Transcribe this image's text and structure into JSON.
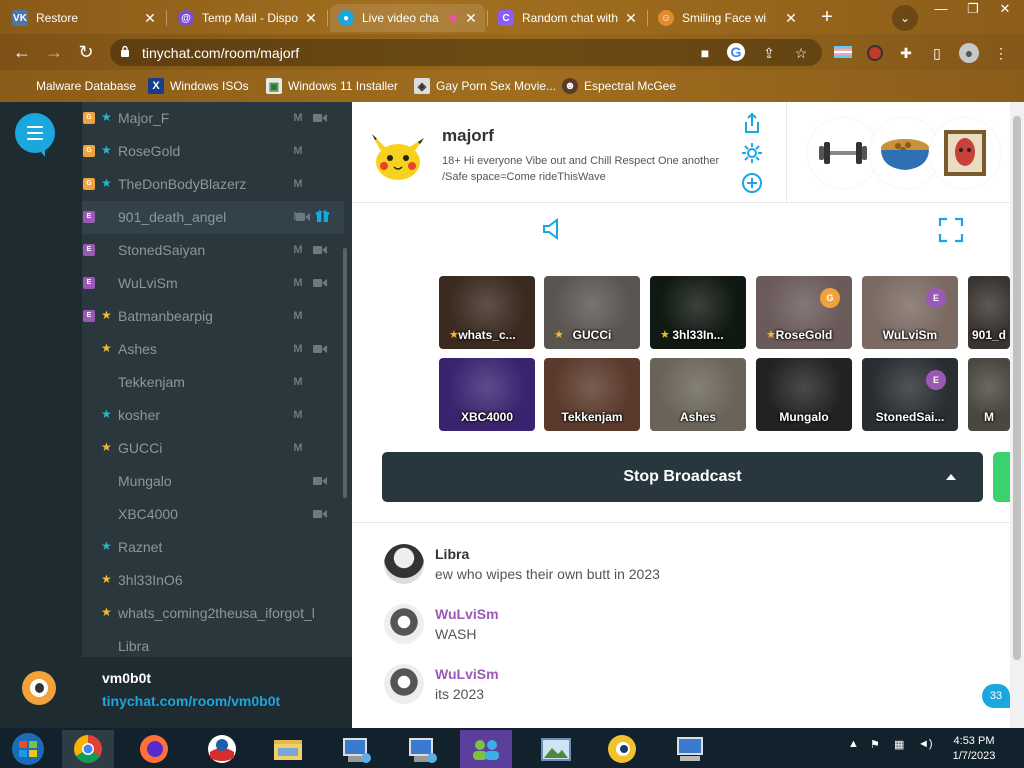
{
  "browser": {
    "tabs": [
      {
        "title": "Restore",
        "icon": "vk-icon",
        "color": "#4a76a8"
      },
      {
        "title": "Temp Mail - Dispo",
        "icon": "tempmail-icon",
        "color": "#7c4dd6"
      },
      {
        "title": "Live video cha",
        "icon": "tinychat-icon",
        "color": "#1aa6de"
      },
      {
        "title": "Random chat with",
        "icon": "chat-c-icon",
        "color": "#8b5cf6"
      },
      {
        "title": "Smiling Face wi",
        "icon": "emoji-icon",
        "color": "#e28b2c"
      }
    ],
    "new_tab": "+",
    "address": "tinychat.com/room/majorf",
    "bookmarks": [
      {
        "label": "Malware Database",
        "icon": "malware-icon"
      },
      {
        "label": "Windows ISOs",
        "icon": "x-icon"
      },
      {
        "label": "Windows 11 Installer",
        "icon": "installer-icon"
      },
      {
        "label": "Gay Porn Sex Movie...",
        "icon": "movie-icon"
      },
      {
        "label": "Espectral McGee",
        "icon": "profile-icon"
      }
    ]
  },
  "userlist": [
    {
      "badge": "G",
      "star": "blue",
      "name": "Major_F",
      "mic": true,
      "cam": true
    },
    {
      "badge": "G",
      "star": "blue",
      "name": "RoseGold",
      "mic": true,
      "cam": false
    },
    {
      "badge": "G",
      "star": "blue",
      "name": "TheDonBodyBlazerz",
      "mic": true,
      "cam": false
    },
    {
      "badge": "E",
      "star": "",
      "name": "901_death_angel",
      "mic": true,
      "cam": true,
      "gift": true
    },
    {
      "badge": "E",
      "star": "",
      "name": "StonedSaiyan",
      "mic": true,
      "cam": true
    },
    {
      "badge": "E",
      "star": "",
      "name": "WuLviSm",
      "mic": true,
      "cam": true
    },
    {
      "badge": "E",
      "star": "gold",
      "name": "Batmanbearpig",
      "mic": true,
      "cam": false
    },
    {
      "badge": "",
      "star": "gold",
      "name": "Ashes",
      "mic": true,
      "cam": true
    },
    {
      "badge": "",
      "star": "",
      "name": "Tekkenjam",
      "mic": true,
      "cam": false
    },
    {
      "badge": "",
      "star": "blue",
      "name": "kosher",
      "mic": true,
      "cam": false
    },
    {
      "badge": "",
      "star": "gold",
      "name": "GUCCi",
      "mic": true,
      "cam": false
    },
    {
      "badge": "",
      "star": "",
      "name": "Mungalo",
      "mic": false,
      "cam": true
    },
    {
      "badge": "",
      "star": "",
      "name": "XBC4000",
      "mic": false,
      "cam": true
    },
    {
      "badge": "",
      "star": "blue",
      "name": "Raznet",
      "mic": false,
      "cam": false
    },
    {
      "badge": "",
      "star": "gold",
      "name": "3hl33InO6",
      "mic": false,
      "cam": false
    },
    {
      "badge": "",
      "star": "gold",
      "name": "whats_coming2theusa_iforgot_l",
      "mic": false,
      "cam": false
    },
    {
      "badge": "",
      "star": "",
      "name": "Libra",
      "mic": false,
      "cam": false
    }
  ],
  "profile": {
    "username": "vm0b0t",
    "link": "tinychat.com/room/vm0b0t"
  },
  "room": {
    "name": "majorf",
    "description": "18+ Hi everyone Vibe out and Chill Respect One another /Safe space=Come rideThisWave"
  },
  "cams": [
    {
      "name": "whats_c...",
      "star": true,
      "badge": "",
      "bg": "#3a2a20"
    },
    {
      "name": "GUCCi",
      "star": true,
      "badge": "",
      "bg": "#5a5550"
    },
    {
      "name": "3hl33In...",
      "star": true,
      "badge": "",
      "bg": "#101812"
    },
    {
      "name": "RoseGold",
      "star": true,
      "badge": "G",
      "bg": "#6a5a5a"
    },
    {
      "name": "WuLviSm",
      "star": false,
      "badge": "E",
      "bg": "#7a6a62"
    },
    {
      "name": "901_d",
      "star": false,
      "badge": "",
      "bg": "#3a3430"
    },
    {
      "name": "XBC4000",
      "star": false,
      "badge": "",
      "bg": "#3a2470"
    },
    {
      "name": "Tekkenjam",
      "star": false,
      "badge": "",
      "bg": "#5a3a2c"
    },
    {
      "name": "Ashes",
      "star": false,
      "badge": "",
      "bg": "#6a6458"
    },
    {
      "name": "Mungalo",
      "star": false,
      "badge": "",
      "bg": "#222222"
    },
    {
      "name": "StonedSai...",
      "star": false,
      "badge": "E",
      "bg": "#2a2e32"
    },
    {
      "name": "M",
      "star": false,
      "badge": "",
      "bg": "#4a4640"
    }
  ],
  "actions": {
    "stop_broadcast": "Stop Broadcast"
  },
  "messages": [
    {
      "name": "Libra",
      "name_color": "#333333",
      "text": "ew who wipes their own butt in 2023"
    },
    {
      "name": "WuLviSm",
      "name_color": "#9b59b6",
      "text": "WASH"
    },
    {
      "name": "WuLviSm",
      "name_color": "#9b59b6",
      "text": "its 2023"
    }
  ],
  "unread_count": "33",
  "clock": {
    "time": "4:53 PM",
    "date": "1/7/2023"
  },
  "colors": {
    "accent": "#1aa6de",
    "sidebar": "#2a373d",
    "gold": "#f5b82e",
    "badge_g": "#f2a23a",
    "badge_e": "#9b59b6",
    "green": "#3bd16f"
  }
}
